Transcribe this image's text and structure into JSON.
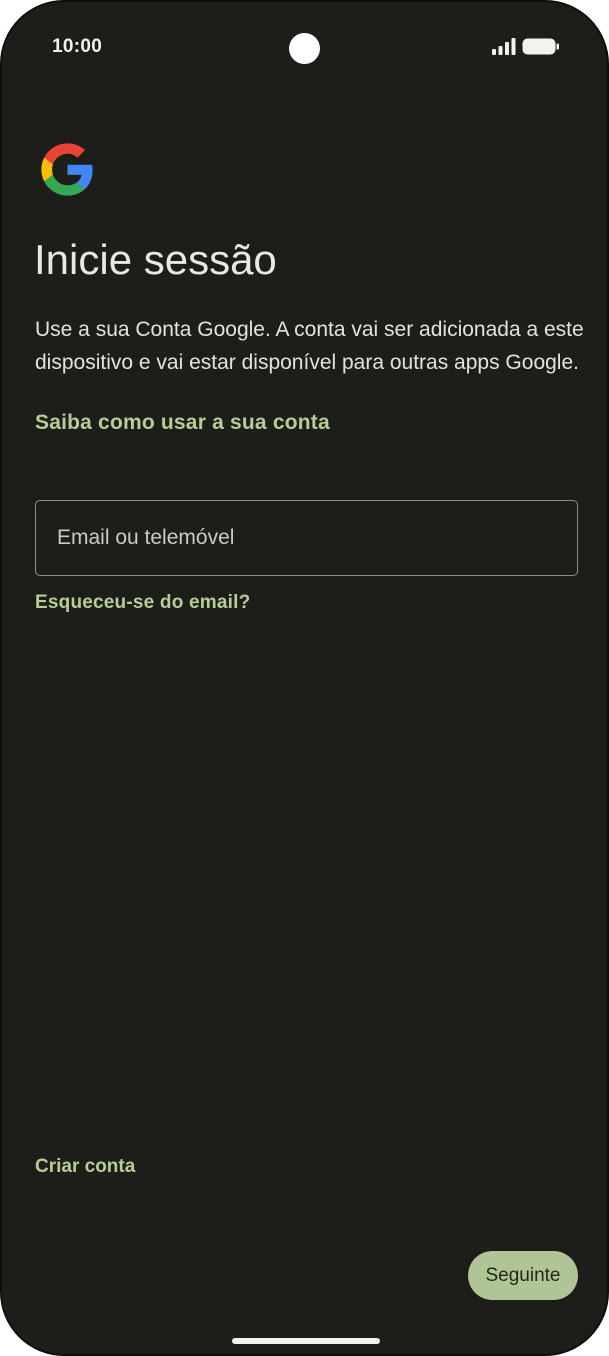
{
  "status_bar": {
    "time": "10:00",
    "icons": [
      "camera-cutout",
      "signal-icon",
      "battery-icon"
    ]
  },
  "logo": {
    "icon": "google-g-logo",
    "colors": {
      "blue": "#4285F4",
      "red": "#EA4335",
      "yellow": "#FBBC05",
      "green": "#34A853"
    }
  },
  "header": {
    "title": "Inicie sessão",
    "description": "Use a sua Conta Google. A conta vai ser adicionada a este dispositivo e vai estar disponível para outras apps Google.",
    "learn_link": "Saiba como usar a sua conta"
  },
  "form": {
    "email_placeholder": "Email ou telemóvel",
    "email_value": "",
    "forgot_email": "Esqueceu-se do email?"
  },
  "footer": {
    "create_account": "Criar conta",
    "next_button": "Seguinte"
  },
  "theme": {
    "background": "#1d1e1a",
    "accent": "#b7cc96",
    "button_fill": "#b1c495"
  }
}
